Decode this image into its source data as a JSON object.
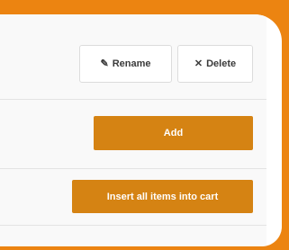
{
  "toolbar": {
    "rename_label": "Rename",
    "delete_label": "Delete",
    "rename_icon": "pencil-icon",
    "delete_icon": "close-icon"
  },
  "actions": {
    "add_label": "Add",
    "insert_all_label": "Insert all items into cart"
  },
  "colors": {
    "background": "#ec8411",
    "accent_button": "#d58313",
    "panel": "#f9f9f9"
  }
}
